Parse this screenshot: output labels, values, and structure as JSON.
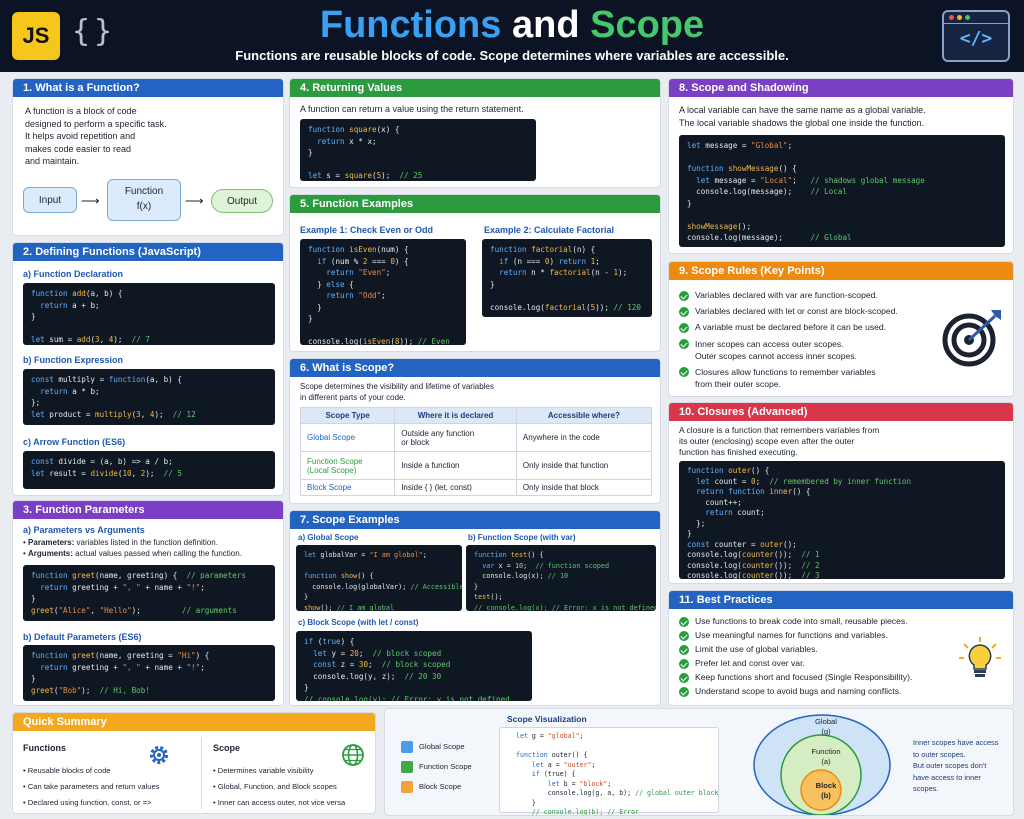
{
  "header": {
    "logo": "JS",
    "braces": "{}",
    "title_part1": "Functions",
    "title_part2": "and",
    "title_part3": "Scope",
    "subtitle": "Functions are reusable blocks of code. Scope determines where variables are accessible.",
    "code_icon": "</>",
    "icons": [
      "js-logo",
      "braces-icon",
      "code-window-icon"
    ]
  },
  "s1": {
    "title": "1. What is a Function?",
    "lines": [
      "A function is a block of code",
      "designed to perform a specific task.",
      "It helps avoid repetition and",
      "makes code easier to read",
      "and maintain."
    ],
    "input": "Input",
    "func": "Function",
    "fx": "f(x)",
    "output": "Output"
  },
  "s2": {
    "title": "2. Defining Functions (JavaScript)",
    "a": "a) Function Declaration",
    "b": "b) Function Expression",
    "c": "c) Arrow Function (ES6)"
  },
  "s3": {
    "title": "3. Function Parameters",
    "a": "a) Parameters vs Arguments",
    "bullet1_bold": "Parameters:",
    "bullet1": " variables listed in the function definition.",
    "bullet2_bold": "Arguments:",
    "bullet2": " actual values passed when calling the function.",
    "b": "b) Default Parameters (ES6)"
  },
  "s4": {
    "title": "4. Returning Values",
    "desc": "A function can return a value using the return statement."
  },
  "s5": {
    "title": "5. Function Examples",
    "ex1": "Example 1: Check Even or Odd",
    "ex2": "Example 2: Calculate Factorial"
  },
  "s6": {
    "title": "6. What is Scope?",
    "desc1": "Scope determines the visibility and lifetime of variables",
    "desc2": "in different parts of your code.",
    "headers": [
      "Scope Type",
      "Where it is declared",
      "Accessible where?"
    ],
    "rows": [
      [
        "Global Scope",
        "Outside any function\nor block",
        "Anywhere in the code"
      ],
      [
        "Function Scope\n(Local Scope)",
        "Inside a function",
        "Only inside that function"
      ],
      [
        "Block Scope",
        "Inside { } (let, const)",
        "Only inside that block"
      ]
    ]
  },
  "s7": {
    "title": "7. Scope Examples",
    "a": "a) Global Scope",
    "b": "b) Function Scope (with var)",
    "c": "c) Block Scope (with let / const)"
  },
  "s8": {
    "title": "8. Scope and Shadowing",
    "desc1": "A local variable can have the same name as a global variable.",
    "desc2": "The local variable shadows the global one inside the function."
  },
  "s9": {
    "title": "9. Scope Rules (Key Points)",
    "items": [
      "Variables declared with var are function-scoped.",
      "Variables declared with let or const are block-scoped.",
      "A variable must be declared before it can be used.",
      "Inner scopes can access outer scopes.\nOuter scopes cannot access inner scopes.",
      "Closures allow functions to remember variables\nfrom their outer scope."
    ],
    "icon": "target-icon"
  },
  "s10": {
    "title": "10. Closures (Advanced)",
    "desc": "A closure is a function that remembers variables from\nits outer (enclosing) scope even after the outer\nfunction has finished executing."
  },
  "s11": {
    "title": "11. Best Practices",
    "items": [
      "Use functions to break code into small, reusable pieces.",
      "Use meaningful names for functions and variables.",
      "Limit the use of global variables.",
      "Prefer let and const over var.",
      "Keep functions short and focused (Single Responsibility).",
      "Understand scope to avoid bugs and naming conflicts."
    ],
    "icon": "lightbulb-icon"
  },
  "summary": {
    "title": "Quick Summary",
    "col1_title": "Functions",
    "col1": [
      "Reusable blocks of code",
      "Can take parameters and return values",
      "Declared using function, const, or =>"
    ],
    "col2_title": "Scope",
    "col2": [
      "Determines variable visibility",
      "Global, Function, and Block scopes",
      "Inner can access outer, not vice versa"
    ],
    "icons": [
      "gear-icon",
      "globe-icon"
    ]
  },
  "viz": {
    "title": "Scope Visualization",
    "legend": [
      "Global Scope",
      "Function Scope",
      "Block Scope"
    ],
    "legend_colors": [
      "#4a9be8",
      "#3fa94a",
      "#f0a43a"
    ],
    "global": "Global",
    "global_g": "(g)",
    "function": "Function",
    "function_a": "(a)",
    "block": "Block",
    "block_b": "(b)",
    "note": "Inner scopes have access\nto outer scopes.\nBut outer scopes don't\nhave access to inner\nscopes."
  },
  "colors": {
    "blue": "#2364c2",
    "green": "#2c9a3f",
    "purple": "#7a3fc4",
    "orange": "#ee8a12",
    "red": "#d9364c",
    "yellow": "#f3a81f"
  }
}
